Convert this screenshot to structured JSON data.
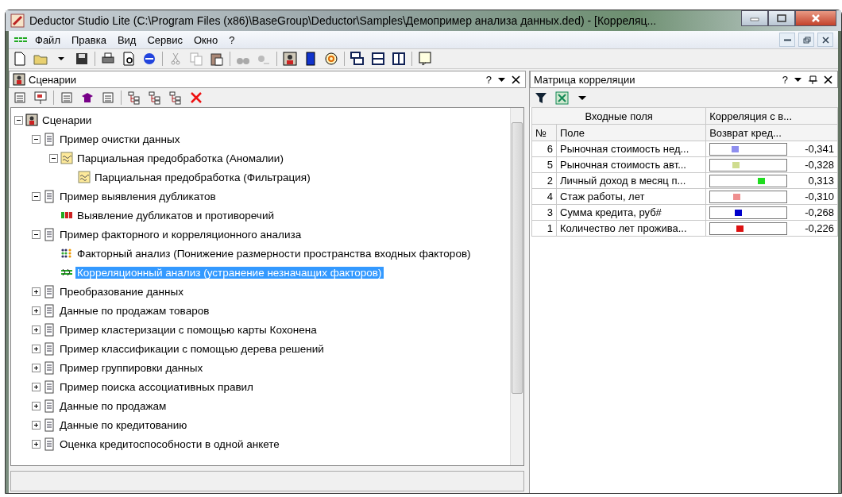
{
  "window": {
    "title": "Deductor Studio Lite (C:\\Program Files (x86)\\BaseGroup\\Deductor\\Samples\\Демопример анализа данных.ded) - [Корреляц..."
  },
  "menu": [
    {
      "label": "Файл"
    },
    {
      "label": "Правка"
    },
    {
      "label": "Вид"
    },
    {
      "label": "Сервис"
    },
    {
      "label": "Окно"
    },
    {
      "label": "?"
    }
  ],
  "scenarios_panel": {
    "title": "Сценарии",
    "help": "?",
    "tree": [
      {
        "label": "Сценарии",
        "kind": "root",
        "expanded": true,
        "selected": false,
        "children": [
          {
            "label": "Пример очистки данных",
            "kind": "doc",
            "expanded": true,
            "selected": false,
            "children": [
              {
                "label": "Парциальная предобработка (Аномалии)",
                "kind": "prep",
                "expanded": true,
                "selected": false,
                "children": [
                  {
                    "label": "Парциальная предобработка (Фильтрация)",
                    "kind": "prep",
                    "selected": false
                  }
                ]
              }
            ]
          },
          {
            "label": "Пример выявления дубликатов",
            "kind": "doc",
            "expanded": true,
            "selected": false,
            "children": [
              {
                "label": "Выявление дубликатов и противоречий",
                "kind": "dup",
                "selected": false
              }
            ]
          },
          {
            "label": "Пример факторного и корреляционного анализа",
            "kind": "doc",
            "expanded": true,
            "selected": false,
            "children": [
              {
                "label": "Факторный анализ (Понижение размерности пространства входных факторов)",
                "kind": "factor",
                "selected": false
              },
              {
                "label": "Корреляционный анализ (устранение незначащих факторов)",
                "kind": "corr",
                "selected": true
              }
            ]
          },
          {
            "label": "Преобразование данных",
            "kind": "doc",
            "expanded": false,
            "selected": false
          },
          {
            "label": "Данные по продажам товаров",
            "kind": "doc",
            "expanded": false,
            "selected": false
          },
          {
            "label": "Пример кластеризации с помощью карты Кохонена",
            "kind": "doc",
            "expanded": false,
            "selected": false
          },
          {
            "label": "Пример классификации с помощью дерева решений",
            "kind": "doc",
            "expanded": false,
            "selected": false
          },
          {
            "label": "Пример группировки данных",
            "kind": "doc",
            "expanded": false,
            "selected": false
          },
          {
            "label": "Пример поиска ассоциативных правил",
            "kind": "doc",
            "expanded": false,
            "selected": false
          },
          {
            "label": "Данные по продажам",
            "kind": "doc",
            "expanded": false,
            "selected": false
          },
          {
            "label": "Данные по кредитованию",
            "kind": "doc",
            "expanded": false,
            "selected": false
          },
          {
            "label": "Оценка кредитоспособности в одной анкете",
            "kind": "doc",
            "expanded": false,
            "selected": false
          }
        ]
      }
    ]
  },
  "matrix_panel": {
    "title": "Матрица корреляции",
    "help": "?",
    "group_headers": [
      "Входные поля",
      "Корреляция с в..."
    ],
    "columns": [
      "№",
      "Поле",
      "Возврат кред..."
    ],
    "rows": [
      {
        "num": "6",
        "field": "Рыночная стоимость нед...",
        "color": "#8f8fef",
        "value": "-0,341"
      },
      {
        "num": "5",
        "field": "Рыночная стоимость авт...",
        "color": "#cfdc8f",
        "value": "-0,328"
      },
      {
        "num": "2",
        "field": "Личный доход в месяц п...",
        "color": "#1fdc1f",
        "value": "0,313"
      },
      {
        "num": "4",
        "field": "Стаж работы, лет",
        "color": "#ef8f8f",
        "value": "-0,310"
      },
      {
        "num": "3",
        "field": "Сумма кредита, руб#",
        "color": "#0000cc",
        "value": "-0,268"
      },
      {
        "num": "1",
        "field": "Количество лет прожива...",
        "color": "#dd1111",
        "value": "-0,226"
      }
    ]
  }
}
